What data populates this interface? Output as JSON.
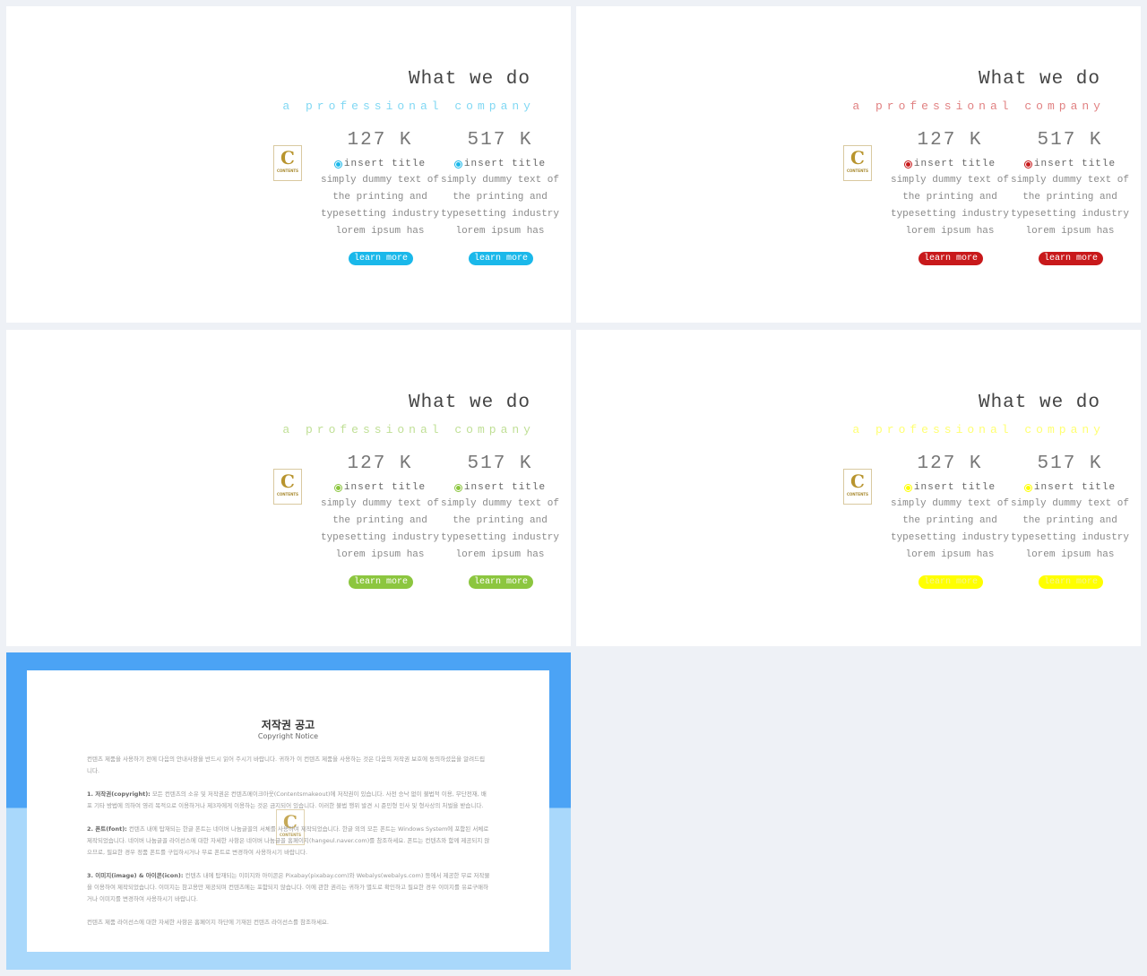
{
  "slides": [
    {
      "title": "What we do",
      "subtitle": "a professional company",
      "accent": "#1ab8ea",
      "button_text_color": "#ffffff",
      "stats": [
        {
          "value": "127 K",
          "label": "insert title",
          "body": "simply dummy text of the printing and typesetting industry lorem ipsum has",
          "button": "learn more"
        },
        {
          "value": "517 K",
          "label": "insert title",
          "body": "simply dummy text of the printing and typesetting industry lorem ipsum has",
          "button": "learn more"
        }
      ]
    },
    {
      "title": "What we do",
      "subtitle": "a professional company",
      "accent": "#c8191b",
      "button_text_color": "#ffffff",
      "stats": [
        {
          "value": "127 K",
          "label": "insert title",
          "body": "simply dummy text of the printing and typesetting industry lorem ipsum has",
          "button": "learn more"
        },
        {
          "value": "517 K",
          "label": "insert title",
          "body": "simply dummy text of the printing and typesetting industry lorem ipsum has",
          "button": "learn more"
        }
      ]
    },
    {
      "title": "What we do",
      "subtitle": "a professional company",
      "accent": "#8cc63f",
      "button_text_color": "#ffffff",
      "stats": [
        {
          "value": "127 K",
          "label": "insert title",
          "body": "simply dummy text of the printing and typesetting industry lorem ipsum has",
          "button": "learn more"
        },
        {
          "value": "517 K",
          "label": "insert title",
          "body": "simply dummy text of the printing and typesetting industry lorem ipsum has",
          "button": "learn more"
        }
      ]
    },
    {
      "title": "What we do",
      "subtitle": "a professional company",
      "accent": "#ffff00",
      "button_text_color": "#f4f49a",
      "stats": [
        {
          "value": "127 K",
          "label": "insert title",
          "body": "simply dummy text of the printing and typesetting industry lorem ipsum has",
          "button": "learn more"
        },
        {
          "value": "517 K",
          "label": "insert title",
          "body": "simply dummy text of the printing and typesetting industry lorem ipsum has",
          "button": "learn more"
        }
      ]
    }
  ],
  "logo": {
    "letter": "C",
    "text": "CONTENTS"
  },
  "notice": {
    "title": "저작권 공고",
    "subtitle": "Copyright Notice",
    "intro": "컨텐츠 제품을 사용하기 전에 다음의 안내사항을 반드시 읽어 주시기 바랍니다. 귀하가 이 컨텐츠 제품을 사용하는 것은 다음의 저작권 보호에 동의하셨음을 알려드립니다.",
    "sections": [
      {
        "head": "1. 저작권(copyright):",
        "text": " 모든 컨텐츠의 소유 및 저작권은 컨텐츠메이크아웃(Contentsmakeout)에 저작권이 있습니다. 사전 승낙 없이 불법적 이용, 무단전재, 배포 기타 방법에 의하여 영리 목적으로 이용하거나 제3자에게 이용하는 것은 금지되어 있습니다. 이러한 불법 행위 발견 시 준민형 민사 및 형사상의 처벌을 받습니다."
      },
      {
        "head": "2. 폰트(font):",
        "text": " 컨텐츠 내에 탑재되는 한글 폰트는 네이버 나눔글꼴의 서체를 사용하여 제작되었습니다. 한글 외의 모든 폰트는 Windows System에 포함된 서체로 제작되었습니다. 네이버 나눔글꼴 라이선스에 대한 자세한 사항은 네이버 나눔글꼴 홈페이지(hangeul.naver.com)를 참조하세요. 폰트는 컨텐츠와 함께 제공되지 않으므로, 필요한 경우 정품 폰트를 구입하시거나 무료 폰트로 변경하여 사용하시기 바랍니다."
      },
      {
        "head": "3. 이미지(image) & 아이콘(icon):",
        "text": " 컨텐츠 내에 탑재되는 이미지와 아이콘은 Pixabay(pixabay.com)와 Webalys(webalys.com) 등에서 제공한 무료 저작물을 이용하여 제작되었습니다. 이미지는 참고용만 제공되며 컨텐츠에는 포함되지 않습니다. 이에 관한 권리는 귀하가 별도로 확인하고 필요한 경우 이미지를 유료구매하거나 이미지를 변경하여 사용하시기 바랍니다."
      }
    ],
    "footer": "컨텐츠 제품 라이선스에 대한 자세한 사항은 홈페이지 하단에 기재된 컨텐츠 라이선스를 참조하세요."
  }
}
